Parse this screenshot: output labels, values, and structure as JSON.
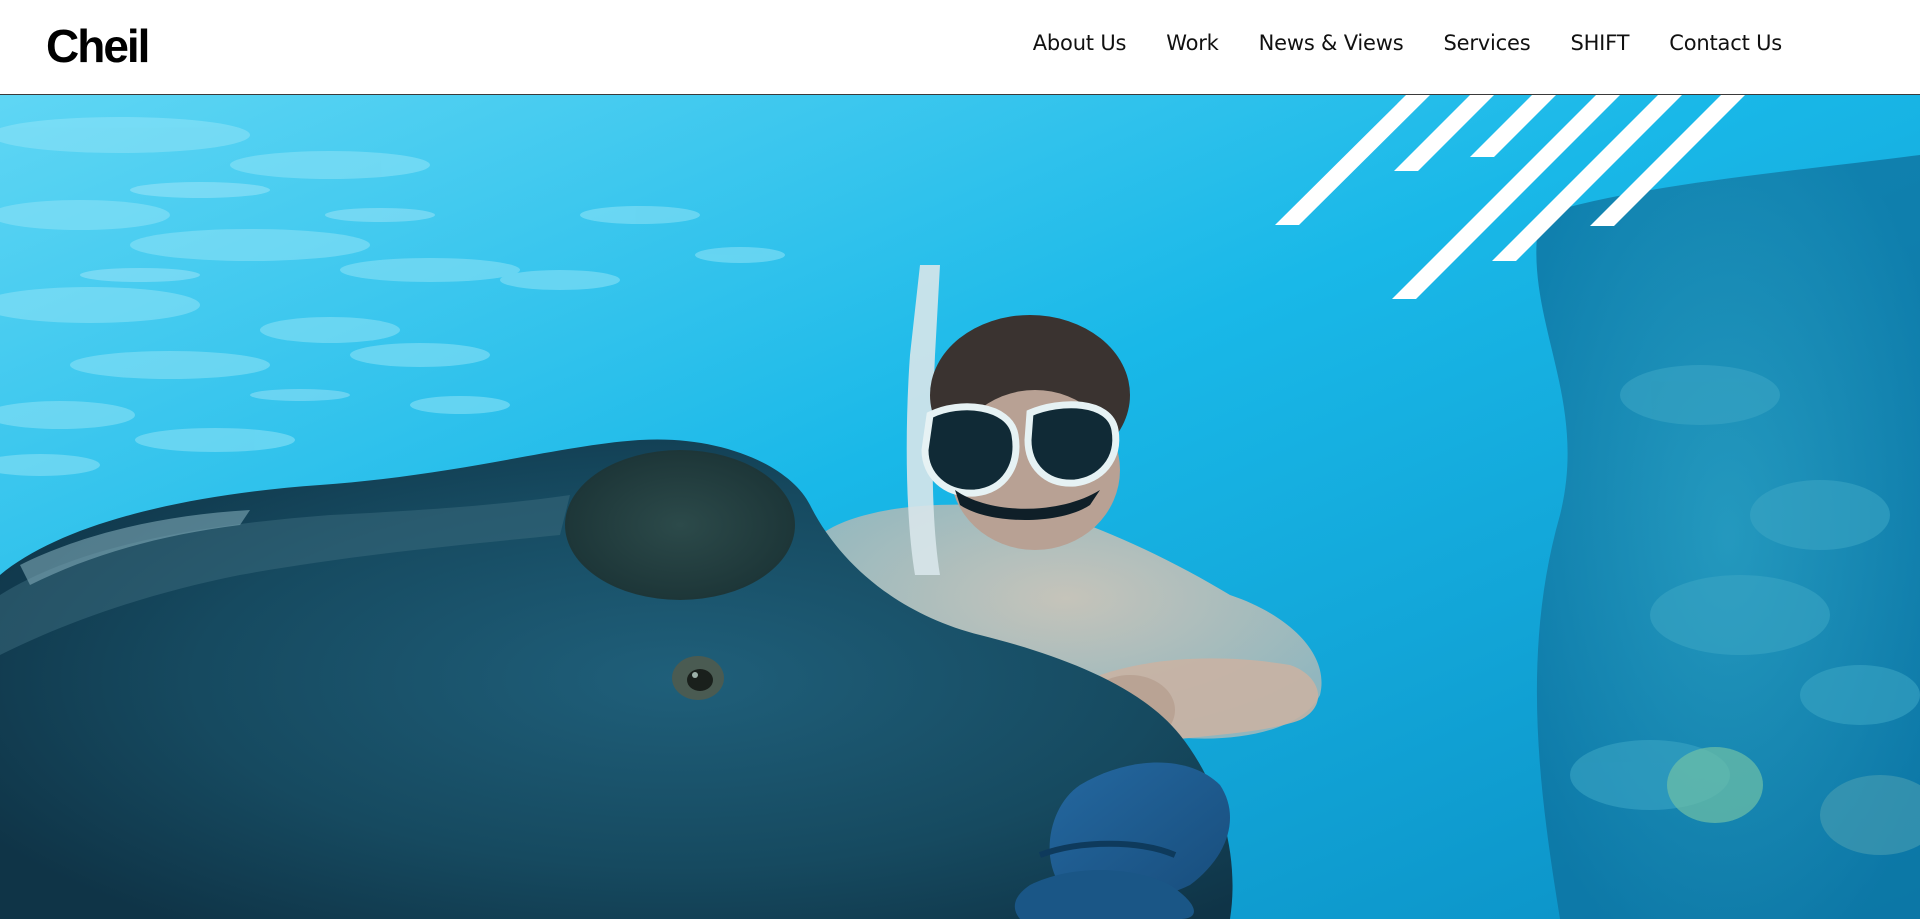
{
  "header": {
    "logo_text": "Cheil",
    "nav": [
      {
        "label": "About Us"
      },
      {
        "label": "Work"
      },
      {
        "label": "News & Views"
      },
      {
        "label": "Services"
      },
      {
        "label": "SHIFT"
      },
      {
        "label": "Contact Us"
      }
    ]
  },
  "colors": {
    "header_bg": "#ffffff",
    "nav_text": "#111111",
    "water": "#1ab7e6",
    "stripes": "#ffffff"
  },
  "hero": {
    "icon": "decorative-diagonal-stripes"
  }
}
